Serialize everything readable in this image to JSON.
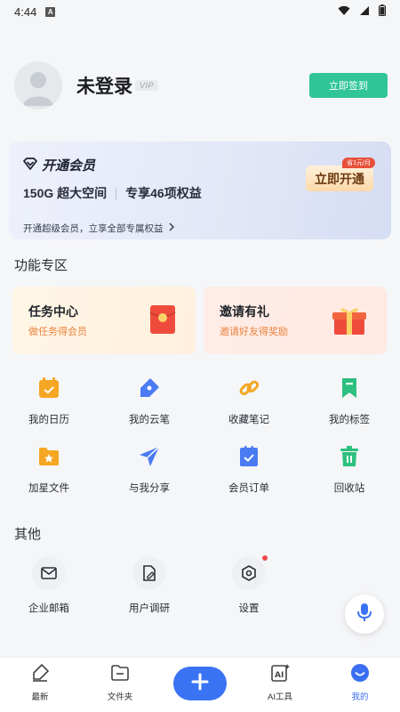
{
  "status_bar": {
    "time": "4:44",
    "badge": "A"
  },
  "profile": {
    "name": "未登录",
    "vip_tag": "VIP",
    "signin_label": "立即签到"
  },
  "vip_card": {
    "title": "开通会员",
    "storage": "150G 超大空间",
    "benefits": "专享46项权益",
    "subtitle": "开通超级会员，立享全部专属权益",
    "cta": "立即开通",
    "discount_badge": "省1元/月"
  },
  "features": {
    "title": "功能专区",
    "promos": [
      {
        "title": "任务中心",
        "subtitle": "做任务得会员"
      },
      {
        "title": "邀请有礼",
        "subtitle": "邀请好友得奖励"
      }
    ],
    "grid": [
      {
        "label": "我的日历",
        "icon": "calendar-icon",
        "color": "#f5a623"
      },
      {
        "label": "我的云笔",
        "icon": "pen-icon",
        "color": "#4a7bf2"
      },
      {
        "label": "收藏笔记",
        "icon": "link-icon",
        "color": "#f5a623"
      },
      {
        "label": "我的标签",
        "icon": "bookmark-icon",
        "color": "#2fbf7f"
      },
      {
        "label": "加星文件",
        "icon": "star-folder-icon",
        "color": "#f5a623"
      },
      {
        "label": "与我分享",
        "icon": "send-icon",
        "color": "#4a7bf2"
      },
      {
        "label": "会员订单",
        "icon": "order-icon",
        "color": "#4a7bf2"
      },
      {
        "label": "回收站",
        "icon": "trash-icon",
        "color": "#2fbf7f"
      }
    ]
  },
  "other": {
    "title": "其他",
    "items": [
      {
        "label": "企业邮箱",
        "icon": "mail-icon"
      },
      {
        "label": "用户调研",
        "icon": "survey-icon"
      },
      {
        "label": "设置",
        "icon": "settings-icon"
      }
    ]
  },
  "bottom_nav": {
    "items": [
      {
        "label": "最新",
        "icon": "latest-icon"
      },
      {
        "label": "文件夹",
        "icon": "folder-icon"
      },
      {
        "label": "AI工具",
        "icon": "ai-tools-icon"
      },
      {
        "label": "我的",
        "icon": "profile-icon",
        "active": true
      }
    ],
    "accent": "#3a6df0"
  }
}
